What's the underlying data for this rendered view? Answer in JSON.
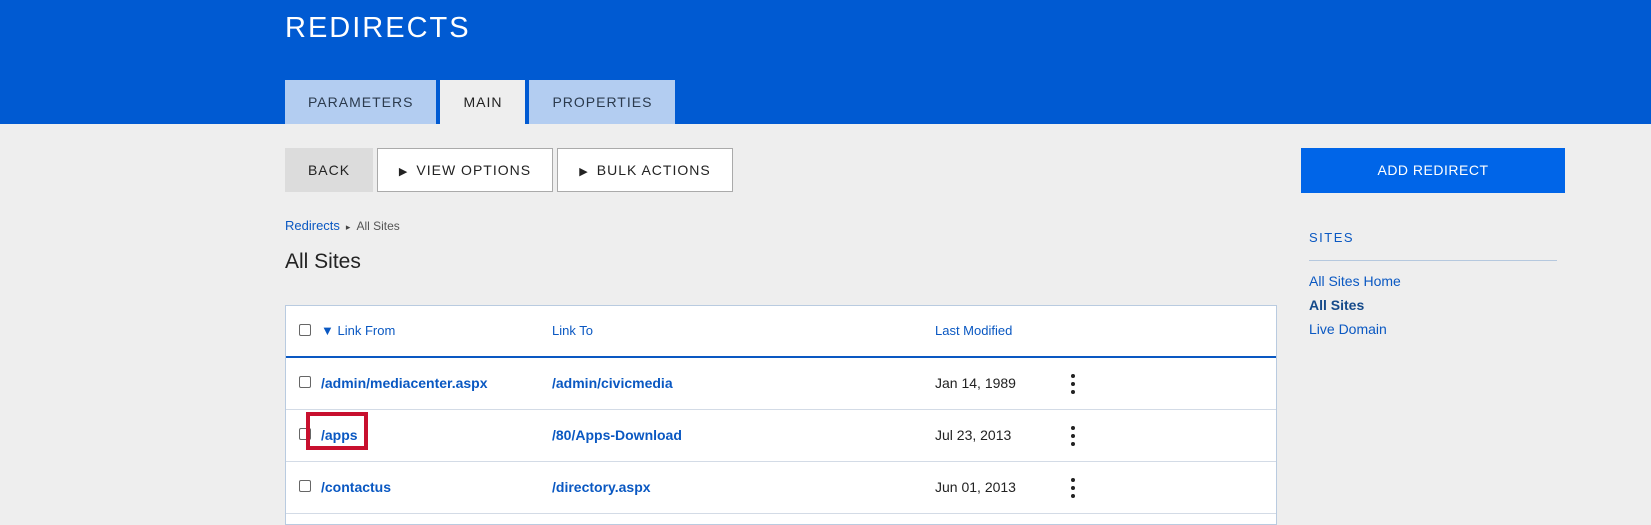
{
  "header": {
    "title": "REDIRECTS",
    "tabs": [
      {
        "label": "PARAMETERS"
      },
      {
        "label": "MAIN"
      },
      {
        "label": "PROPERTIES"
      }
    ]
  },
  "toolbar": {
    "back_label": "BACK",
    "view_options_label": "VIEW OPTIONS",
    "bulk_actions_label": "BULK ACTIONS",
    "add_label": "ADD REDIRECT"
  },
  "breadcrumb": {
    "link": "Redirects",
    "separator": "▸",
    "current": "All Sites"
  },
  "section_title": "All Sites",
  "table": {
    "columns": {
      "sort_indicator": "▼",
      "link_from": "Link From",
      "link_to": "Link To",
      "last_modified": "Last Modified"
    },
    "rows": [
      {
        "from": "/admin/mediacenter.aspx",
        "to": "/admin/civicmedia",
        "modified": "Jan 14, 1989"
      },
      {
        "from": "/apps",
        "to": "/80/Apps-Download",
        "modified": "Jul 23, 2013"
      },
      {
        "from": "/contactus",
        "to": "/directory.aspx",
        "modified": "Jun 01, 2013"
      }
    ]
  },
  "sidebar": {
    "heading": "SITES",
    "links": [
      {
        "label": "All Sites Home"
      },
      {
        "label": "All Sites"
      },
      {
        "label": "Live Domain"
      }
    ]
  },
  "icons": {
    "play": "▶",
    "kebab": "more-vertical-icon"
  },
  "colors": {
    "header_bg": "#005ad2",
    "accent_blue": "#0065e8",
    "link_blue": "#0a58c2",
    "highlight_red": "#c8102e"
  }
}
